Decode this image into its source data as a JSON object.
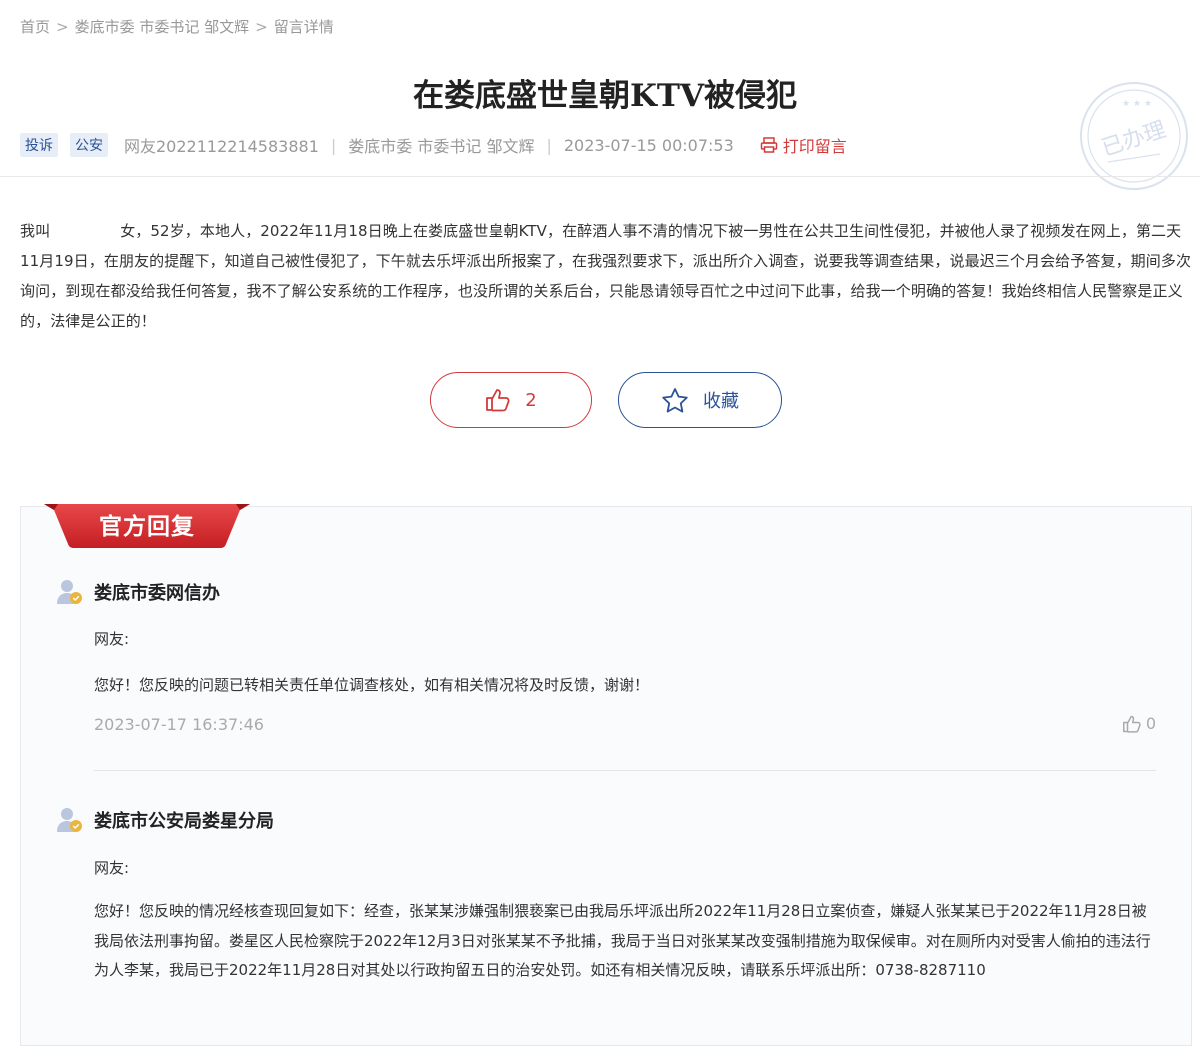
{
  "breadcrumb": {
    "items": [
      "首页",
      "娄底市委 市委书记 邹文辉",
      "留言详情"
    ],
    "separator": ">"
  },
  "title": "在娄底盛世皇朝KTV被侵犯",
  "meta": {
    "tags": [
      "投诉",
      "公安"
    ],
    "author": "网友2022112214583881",
    "recipient": "娄底市委 市委书记 邹文辉",
    "datetime": "2023-07-15 00:07:53",
    "print_label": "打印留言",
    "divider": "|"
  },
  "stamp": {
    "text": "已办理"
  },
  "content": {
    "before_mask": "我叫",
    "after_mask": "女，52岁，本地人，2022年11月18日晚上在娄底盛世皇朝KTV，在醉酒人事不清的情况下被一男性在公共卫生间性侵犯，并被他人录了视频发在网上，第二天11月19日，在朋友的提醒下，知道自己被性侵犯了，下午就去乐坪派出所报案了，在我强烈要求下，派出所介入调查，说要我等调查结果，说最迟三个月会给予答复，期间多次询问，到现在都没给我任何答复，我不了解公安系统的工作程序，也没所谓的关系后台，只能恳请领导百忙之中过问下此事，给我一个明确的答复！我始终相信人民警察是正义的，法律是公正的！"
  },
  "actions": {
    "like_count": "2",
    "favorite_label": "收藏"
  },
  "official": {
    "heading": "官方回复",
    "replies": [
      {
        "org": "娄底市委网信办",
        "greeting": "网友:",
        "text": "您好！您反映的问题已转相关责任单位调查核处，如有相关情况将及时反馈，谢谢！",
        "date": "2023-07-17 16:37:46",
        "likes": "0"
      },
      {
        "org": "娄底市公安局娄星分局",
        "greeting": "网友:",
        "text": "您好！您反映的情况经核查现回复如下：经查，张某某涉嫌强制猥亵案已由我局乐坪派出所2022年11月28日立案侦查，嫌疑人张某某已于2022年11月28日被我局依法刑事拘留。娄星区人民检察院于2022年12月3日对张某某不予批捕，我局于当日对张某某改变强制措施为取保候审。对在厕所内对受害人偷拍的违法行为人李某，我局已于2022年11月28日对其处以行政拘留五日的治安处罚。如还有相关情况反映，请联系乐坪派出所：0738-8287110"
      }
    ]
  },
  "colors": {
    "accent_red": "#d33a3a",
    "accent_blue": "#2a5298"
  }
}
